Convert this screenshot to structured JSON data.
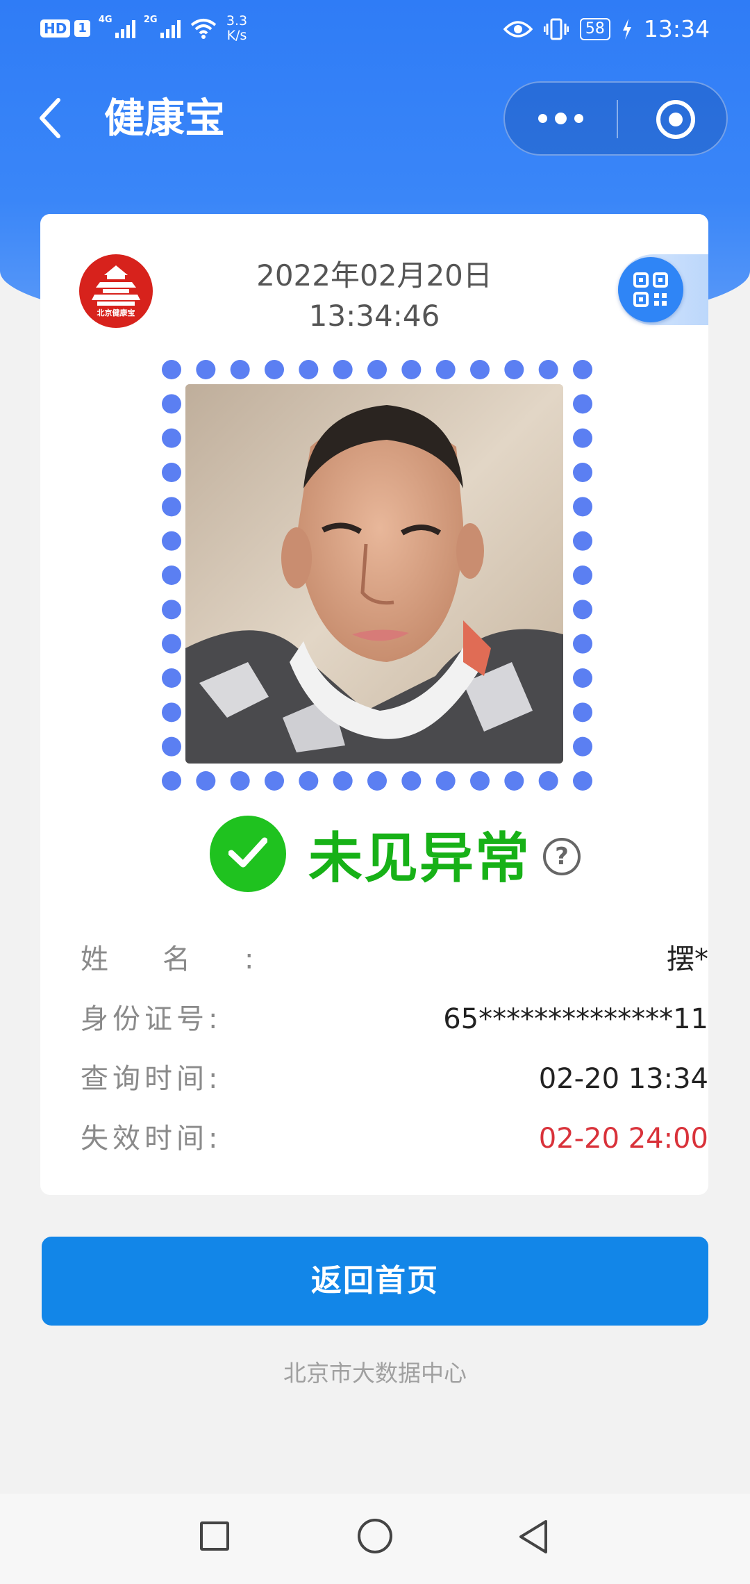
{
  "status_bar": {
    "hd": "HD",
    "sim": "1",
    "net1": "4G",
    "net2": "2G",
    "speed_value": "3.3",
    "speed_unit": "K/s",
    "battery": "58",
    "time": "13:34"
  },
  "nav": {
    "title": "健康宝"
  },
  "card": {
    "logo_text": "北京健康宝",
    "date": "2022年02月20日",
    "time": "13:34:46",
    "status_text": "未见异常",
    "help_symbol": "?",
    "status_color": "#1fc21f",
    "rows": [
      {
        "label": "姓名:",
        "value": "摆*"
      },
      {
        "label": "身份证号:",
        "value": "65**************11"
      },
      {
        "label": "查询时间:",
        "value": "02-20 13:34"
      },
      {
        "label": "失效时间:",
        "value": "02-20 24:00"
      }
    ]
  },
  "actions": {
    "home_button": "返回首页"
  },
  "footer": {
    "text": "北京市大数据中心"
  },
  "colors": {
    "header_blue": "#2f7cf6",
    "button_blue": "#1286e8",
    "expire_red": "#d9323a",
    "dot_blue": "#5b7ff2"
  }
}
